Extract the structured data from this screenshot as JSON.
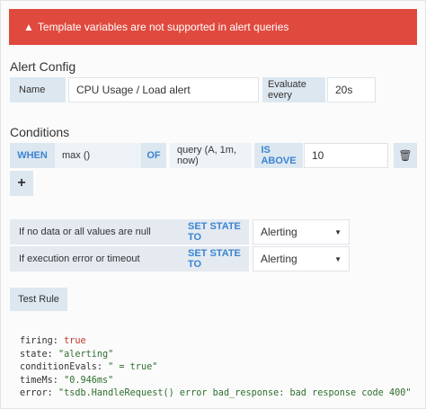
{
  "banner": {
    "icon": "warning-icon",
    "icon_glyph": "▲",
    "message": "Template variables are not supported in alert queries"
  },
  "alert_config": {
    "title": "Alert Config",
    "name_label": "Name",
    "name_value": "CPU Usage / Load alert",
    "evaluate_label": "Evaluate every",
    "evaluate_value": "20s"
  },
  "conditions": {
    "title": "Conditions",
    "when": "WHEN",
    "reducer": "max ()",
    "of": "OF",
    "query": "query (A, 1m, now)",
    "comparator": "IS ABOVE",
    "threshold": "10",
    "delete_icon": "trash-icon",
    "delete_glyph": "🗑",
    "add_glyph": "+"
  },
  "no_data": {
    "label": "If no data or all values are null",
    "action": "SET STATE TO",
    "value": "Alerting"
  },
  "exec_error": {
    "label": "If execution error or timeout",
    "action": "SET STATE TO",
    "value": "Alerting"
  },
  "test_rule": {
    "label": "Test Rule"
  },
  "result": {
    "firing_key": "firing: ",
    "firing_val": "true",
    "state_key": "state: ",
    "state_val": "\"alerting\"",
    "cond_key": "conditionEvals: ",
    "cond_val": "\" = true\"",
    "time_key": "timeMs: ",
    "time_val": "\"0.946ms\"",
    "error_key": "error: ",
    "error_val": "\"tsdb.HandleRequest() error bad_response: bad response code 400\""
  },
  "colors": {
    "banner": "#e0493e",
    "keyword": "#3b84d3",
    "label_bg": "#dde7f0"
  }
}
